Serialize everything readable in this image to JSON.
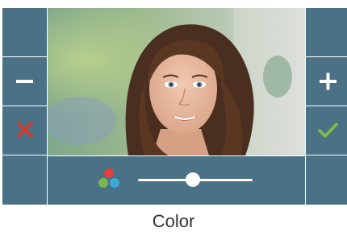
{
  "caption": "Color",
  "left_buttons": [
    {
      "name": "blank-button-top-left",
      "icon": "none"
    },
    {
      "name": "minus-button",
      "icon": "minus-icon"
    },
    {
      "name": "cancel-button",
      "icon": "close-icon"
    },
    {
      "name": "blank-button-bottom-left",
      "icon": "none"
    }
  ],
  "right_buttons": [
    {
      "name": "blank-button-top-right",
      "icon": "none"
    },
    {
      "name": "plus-button",
      "icon": "plus-icon"
    },
    {
      "name": "confirm-button",
      "icon": "check-icon"
    },
    {
      "name": "blank-button-bottom-right",
      "icon": "none"
    }
  ],
  "color_setting": {
    "icon": "color-dots-icon",
    "level": 0.48
  },
  "colors": {
    "panel": "#4a7186",
    "cancel": "#d9362b",
    "confirm": "#7cc242",
    "dot_red": "#e2403a",
    "dot_green": "#7ab648",
    "dot_blue": "#3aa9d8"
  }
}
